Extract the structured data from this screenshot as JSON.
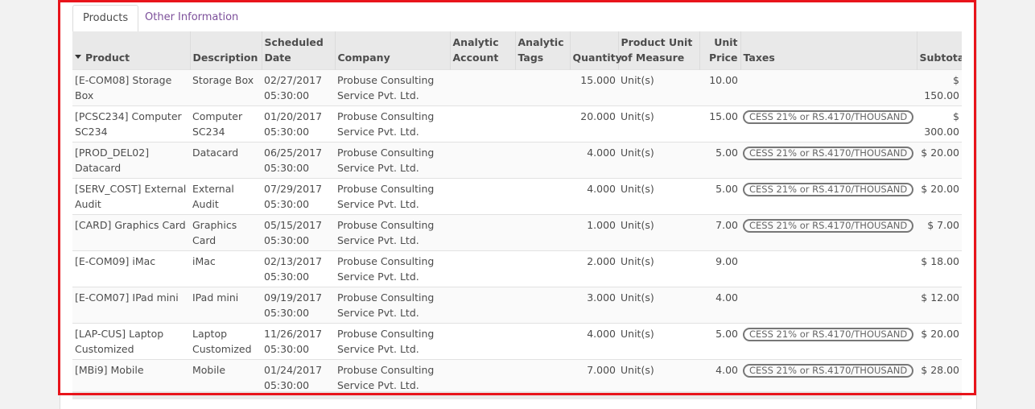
{
  "tabs": [
    {
      "label": "Products",
      "active": true
    },
    {
      "label": "Other Information",
      "active": false
    }
  ],
  "columns": {
    "product": "Product",
    "description": "Description",
    "scheduled_date": "Scheduled Date",
    "company": "Company",
    "analytic_account": "Analytic Account",
    "analytic_tags": "Analytic Tags",
    "quantity": "Quantity",
    "uom": "Product Unit of Measure",
    "unit_price": "Unit Price",
    "taxes": "Taxes",
    "subtotal": "Subtotal"
  },
  "rows": [
    {
      "product": "[E-COM08] Storage Box",
      "description": "Storage Box",
      "date": "02/27/2017 05:30:00",
      "company": "Probuse Consulting Service Pvt. Ltd.",
      "analytic_account": "",
      "analytic_tags": "",
      "quantity": "15.000",
      "uom": "Unit(s)",
      "price": "10.00",
      "tax": "",
      "subtotal": "$ 150.00"
    },
    {
      "product": "[PCSC234] Computer SC234",
      "description": "Computer SC234",
      "date": "01/20/2017 05:30:00",
      "company": "Probuse Consulting Service Pvt. Ltd.",
      "analytic_account": "",
      "analytic_tags": "",
      "quantity": "20.000",
      "uom": "Unit(s)",
      "price": "15.00",
      "tax": "CESS 21% or RS.4170/THOUSAND",
      "subtotal": "$ 300.00"
    },
    {
      "product": "[PROD_DEL02] Datacard",
      "description": "Datacard",
      "date": "06/25/2017 05:30:00",
      "company": "Probuse Consulting Service Pvt. Ltd.",
      "analytic_account": "",
      "analytic_tags": "",
      "quantity": "4.000",
      "uom": "Unit(s)",
      "price": "5.00",
      "tax": "CESS 21% or RS.4170/THOUSAND",
      "subtotal": "$ 20.00"
    },
    {
      "product": "[SERV_COST] External Audit",
      "description": "External Audit",
      "date": "07/29/2017 05:30:00",
      "company": "Probuse Consulting Service Pvt. Ltd.",
      "analytic_account": "",
      "analytic_tags": "",
      "quantity": "4.000",
      "uom": "Unit(s)",
      "price": "5.00",
      "tax": "CESS 21% or RS.4170/THOUSAND",
      "subtotal": "$ 20.00"
    },
    {
      "product": "[CARD] Graphics Card",
      "description": "Graphics Card",
      "date": "05/15/2017 05:30:00",
      "company": "Probuse Consulting Service Pvt. Ltd.",
      "analytic_account": "",
      "analytic_tags": "",
      "quantity": "1.000",
      "uom": "Unit(s)",
      "price": "7.00",
      "tax": "CESS 21% or RS.4170/THOUSAND",
      "subtotal": "$ 7.00"
    },
    {
      "product": "[E-COM09] iMac",
      "description": "iMac",
      "date": "02/13/2017 05:30:00",
      "company": "Probuse Consulting Service Pvt. Ltd.",
      "analytic_account": "",
      "analytic_tags": "",
      "quantity": "2.000",
      "uom": "Unit(s)",
      "price": "9.00",
      "tax": "",
      "subtotal": "$ 18.00"
    },
    {
      "product": "[E-COM07] IPad mini",
      "description": "IPad mini",
      "date": "09/19/2017 05:30:00",
      "company": "Probuse Consulting Service Pvt. Ltd.",
      "analytic_account": "",
      "analytic_tags": "",
      "quantity": "3.000",
      "uom": "Unit(s)",
      "price": "4.00",
      "tax": "",
      "subtotal": "$ 12.00"
    },
    {
      "product": "[LAP-CUS] Laptop Customized",
      "description": "Laptop Customized",
      "date": "11/26/2017 05:30:00",
      "company": "Probuse Consulting Service Pvt. Ltd.",
      "analytic_account": "",
      "analytic_tags": "",
      "quantity": "4.000",
      "uom": "Unit(s)",
      "price": "5.00",
      "tax": "CESS 21% or RS.4170/THOUSAND",
      "subtotal": "$ 20.00"
    },
    {
      "product": "[MBi9] Mobile",
      "description": "Mobile",
      "date": "01/24/2017 05:30:00",
      "company": "Probuse Consulting Service Pvt. Ltd.",
      "analytic_account": "",
      "analytic_tags": "",
      "quantity": "7.000",
      "uom": "Unit(s)",
      "price": "4.00",
      "tax": "CESS 21% or RS.4170/THOUSAND",
      "subtotal": "$ 28.00"
    }
  ],
  "colors": {
    "highlight": "#e8141b",
    "tab_link": "#7c4f9a",
    "header_bg": "#e9e9e9"
  },
  "icons": {
    "sort": "caret-down-icon"
  }
}
